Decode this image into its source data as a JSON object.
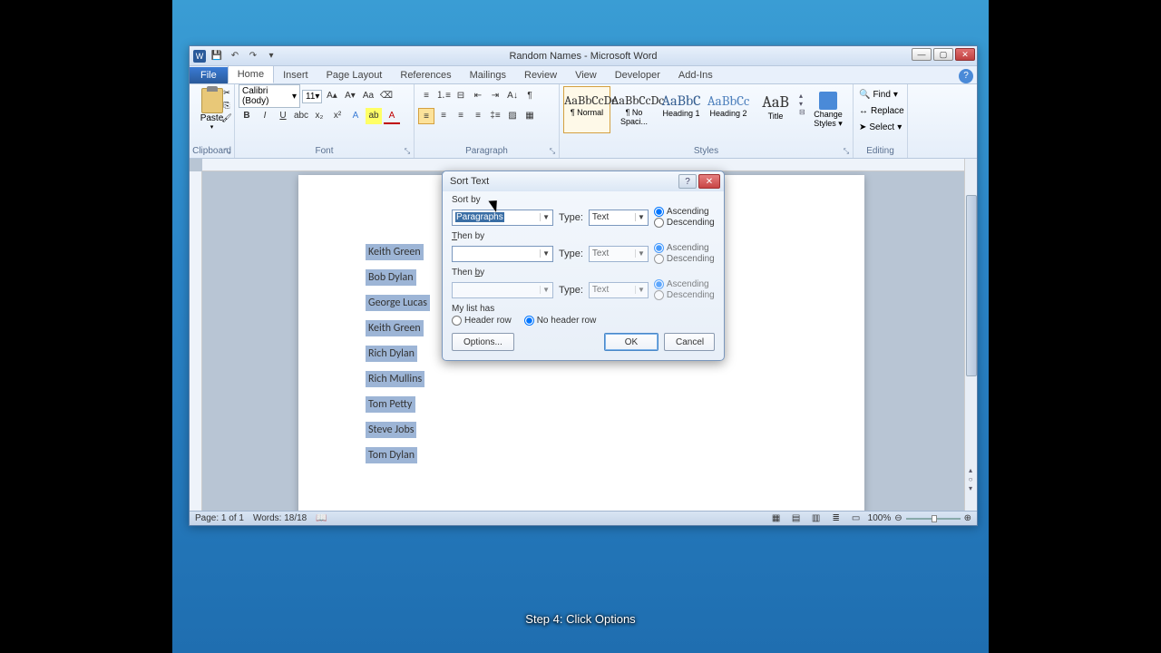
{
  "window": {
    "title": "Random Names - Microsoft Word"
  },
  "tabs": {
    "file": "File",
    "home": "Home",
    "insert": "Insert",
    "pagelayout": "Page Layout",
    "references": "References",
    "mailings": "Mailings",
    "review": "Review",
    "view": "View",
    "developer": "Developer",
    "addins": "Add-Ins"
  },
  "ribbon": {
    "clipboard": {
      "paste": "Paste",
      "label": "Clipboard"
    },
    "font": {
      "name": "Calibri (Body)",
      "size": "11",
      "label": "Font"
    },
    "paragraph": {
      "label": "Paragraph"
    },
    "styles": {
      "label": "Styles",
      "items": [
        {
          "preview": "AaBbCcDc",
          "name": "¶ Normal"
        },
        {
          "preview": "AaBbCcDc",
          "name": "¶ No Spaci..."
        },
        {
          "preview": "AaBbC",
          "name": "Heading 1"
        },
        {
          "preview": "AaBbCc",
          "name": "Heading 2"
        },
        {
          "preview": "AaB",
          "name": "Title"
        }
      ],
      "change": "Change Styles"
    },
    "editing": {
      "find": "Find",
      "replace": "Replace",
      "select": "Select",
      "label": "Editing"
    }
  },
  "names": [
    "Keith Green",
    "Bob Dylan",
    "George Lucas",
    "Keith Green",
    "Rich Dylan",
    "Rich Mullins",
    "Tom Petty",
    "Steve Jobs",
    "Tom Dylan"
  ],
  "dialog": {
    "title": "Sort Text",
    "sortby": "Sort by",
    "thenby": "Then by",
    "field1": "Paragraphs",
    "typelabel": "Type:",
    "typeval": "Text",
    "asc": "Ascending",
    "desc": "Descending",
    "listhas": "My list has",
    "header": "Header row",
    "noheader": "No header row",
    "options": "Options...",
    "ok": "OK",
    "cancel": "Cancel"
  },
  "status": {
    "page": "Page: 1 of 1",
    "words": "Words: 18/18",
    "zoom": "100%"
  },
  "caption": "Step 4: Click Options"
}
